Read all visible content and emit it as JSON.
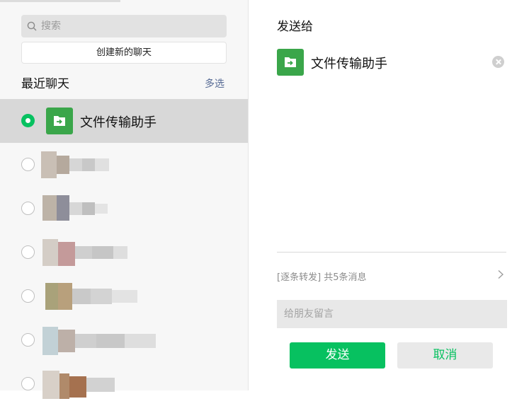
{
  "left": {
    "search": {
      "placeholder": "搜索"
    },
    "create_chat": "创建新的聊天",
    "recent_title": "最近聊天",
    "multi_select": "多选",
    "chats": [
      {
        "name": "文件传输助手",
        "selected": true,
        "icon": "file-transfer-icon"
      },
      {
        "name": "",
        "selected": false,
        "blurred": true
      },
      {
        "name": "",
        "selected": false,
        "blurred": true
      },
      {
        "name": "",
        "selected": false,
        "blurred": true
      },
      {
        "name": "",
        "selected": false,
        "blurred": true
      },
      {
        "name": "",
        "selected": false,
        "blurred": true
      },
      {
        "name": "",
        "selected": false,
        "blurred": true
      }
    ]
  },
  "right": {
    "title": "发送给",
    "recipient": {
      "name": "文件传输助手",
      "icon": "file-transfer-icon"
    },
    "forward_info": "[逐条转发] 共5条消息",
    "message_placeholder": "给朋友留言",
    "send_label": "发送",
    "cancel_label": "取消"
  },
  "colors": {
    "accent": "#07c160",
    "file_icon": "#3aa64a",
    "link": "#576b95"
  }
}
